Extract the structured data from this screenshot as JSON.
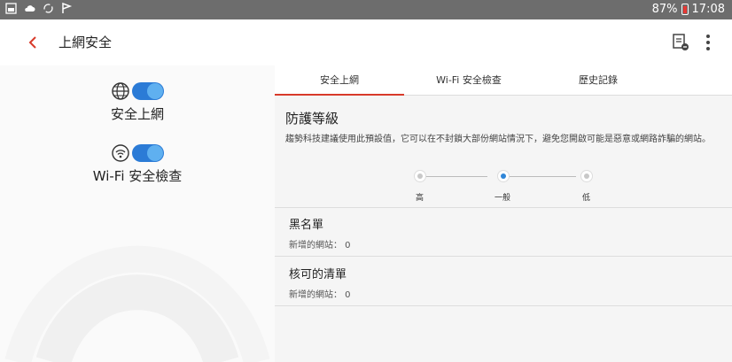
{
  "status_bar": {
    "battery": "87%",
    "time": "17:08"
  },
  "app_bar": {
    "title": "上網安全"
  },
  "features": [
    {
      "label": "安全上網",
      "enabled": true
    },
    {
      "label": "Wi-Fi 安全檢查",
      "enabled": true
    }
  ],
  "tabs": [
    {
      "label": "安全上網",
      "active": true
    },
    {
      "label": "Wi-Fi 安全檢查",
      "active": false
    },
    {
      "label": "歷史記錄",
      "active": false
    }
  ],
  "protection": {
    "title": "防護等級",
    "description": "趨勢科技建議使用此預設值，它可以在不封鎖大部份網站情況下，避免您開啟可能是惡意或網路詐騙的網站。",
    "levels": [
      "高",
      "一般",
      "低"
    ],
    "selected_level": "一般"
  },
  "blacklist": {
    "title": "黑名單",
    "subtitle": "新增的網站： 0"
  },
  "approved_list": {
    "title": "核可的清單",
    "subtitle": "新增的網站： 0"
  },
  "colors": {
    "accent": "#d83a2a",
    "toggle": "#2b7bd6",
    "selected_knob": "#2f86d8"
  }
}
